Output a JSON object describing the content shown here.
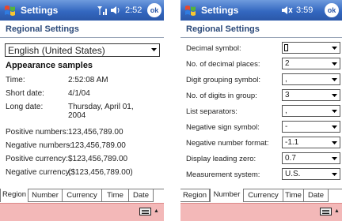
{
  "left": {
    "title": "Settings",
    "time": "2:52",
    "ok_label": "ok",
    "heading": "Regional Settings",
    "locale": "English (United States)",
    "samples_title": "Appearance samples",
    "samples": [
      {
        "label": "Time:",
        "value": "2:52:08 AM"
      },
      {
        "label": "Short date:",
        "value": "4/1/04"
      },
      {
        "label": "Long date:",
        "value": "Thursday, April 01, 2004"
      },
      {
        "label": "Positive numbers:",
        "value": "123,456,789.00"
      },
      {
        "label": "Negative numbers:",
        "value": "-123,456,789.00"
      },
      {
        "label": "Positive currency:",
        "value": "$123,456,789.00"
      },
      {
        "label": "Negative currency:",
        "value": "($123,456,789.00)"
      }
    ],
    "tabs": [
      "Region",
      "Number",
      "Currency",
      "Time",
      "Date"
    ],
    "active_tab": "Region"
  },
  "right": {
    "title": "Settings",
    "time": "3:59",
    "ok_label": "ok",
    "heading": "Regional Settings",
    "rows": [
      {
        "label": "Decimal symbol:",
        "value": ""
      },
      {
        "label": "No. of decimal places:",
        "value": "2"
      },
      {
        "label": "Digit grouping symbol:",
        "value": ","
      },
      {
        "label": "No. of digits in group:",
        "value": "3"
      },
      {
        "label": "List separators:",
        "value": ","
      },
      {
        "label": "Negative sign symbol:",
        "value": "-"
      },
      {
        "label": "Negative number format:",
        "value": "-1.1"
      },
      {
        "label": "Display leading zero:",
        "value": "0.7"
      },
      {
        "label": "Measurement system:",
        "value": "U.S."
      }
    ],
    "tabs": [
      "Region",
      "Number",
      "Currency",
      "Time",
      "Date"
    ],
    "active_tab": "Number"
  },
  "colors": {
    "titlebar": "#3468c0",
    "heading": "#2c4a7a",
    "bottombar": "#f3b8b8"
  },
  "icons": [
    "windows-flag-icon",
    "signal-icon",
    "speaker-icon",
    "ok-icon",
    "keyboard-icon",
    "chevron-down-icon"
  ]
}
